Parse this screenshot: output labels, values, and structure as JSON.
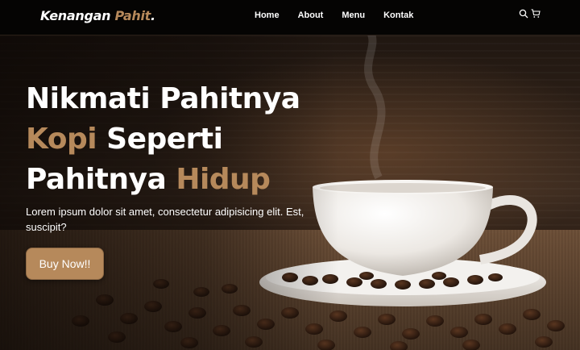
{
  "brand": {
    "name": "Kenangan",
    "name_accent": "Pahit",
    "dot": "."
  },
  "nav": {
    "links": [
      {
        "label": "Home"
      },
      {
        "label": "About"
      },
      {
        "label": "Menu"
      },
      {
        "label": "Kontak"
      }
    ],
    "icons": [
      "search-icon",
      "cart-icon"
    ]
  },
  "hero": {
    "line1": "Nikmati Pahitnya",
    "line2_accent": "Kopi",
    "line2_rest": " Seperti",
    "line3_rest": "Pahitnya ",
    "line3_accent": "Hidup",
    "description": "Lorem ipsum dolor sit amet, consectetur adipisicing elit. Est, suscipit?",
    "cta_label": "Buy Now!!"
  },
  "colors": {
    "accent": "#b6895b",
    "navbar": "#050403",
    "text": "#ffffff"
  }
}
